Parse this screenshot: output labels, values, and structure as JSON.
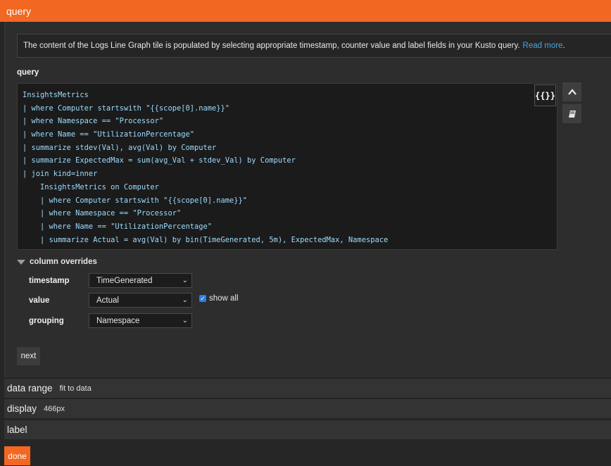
{
  "header": {
    "title": "query"
  },
  "info": {
    "text": "The content of the Logs Line Graph tile is populated by selecting appropriate timestamp, counter value and label fields in your Kusto query.",
    "link": "Read more",
    "suffix": "."
  },
  "query": {
    "label": "query",
    "format_label": "{{}}",
    "lines": [
      "InsightsMetrics",
      "| where Computer startswith \"{{scope[0].name}}\"",
      "| where Namespace == \"Processor\"",
      "| where Name == \"UtilizationPercentage\"",
      "| summarize stdev(Val), avg(Val) by Computer",
      "| summarize ExpectedMax = sum(avg_Val + stdev_Val) by Computer",
      "| join kind=inner",
      "    InsightsMetrics on Computer",
      "    | where Computer startswith \"{{scope[0].name}}\"",
      "    | where Namespace == \"Processor\"",
      "    | where Name == \"UtilizationPercentage\"",
      "    | summarize Actual = avg(Val) by bin(TimeGenerated, 5m), ExpectedMax, Namespace"
    ]
  },
  "overrides": {
    "title": "column overrides",
    "fields": [
      {
        "label": "timestamp",
        "value": "TimeGenerated"
      },
      {
        "label": "value",
        "value": "Actual"
      },
      {
        "label": "grouping",
        "value": "Namespace"
      }
    ],
    "show_all_label": "show all",
    "show_all_checked": true
  },
  "next_label": "next",
  "sections": [
    {
      "title": "data range",
      "sub": "fit to data"
    },
    {
      "title": "display",
      "sub": "466px"
    },
    {
      "title": "label",
      "sub": ""
    }
  ],
  "done_label": "done",
  "colors": {
    "accent": "#f26722",
    "link": "#4aa3e0",
    "checkbox": "#2b7de9"
  },
  "icons": {
    "collapse": "chevron-up-icon",
    "docs": "book-icon",
    "expand": "caret-down-icon"
  }
}
